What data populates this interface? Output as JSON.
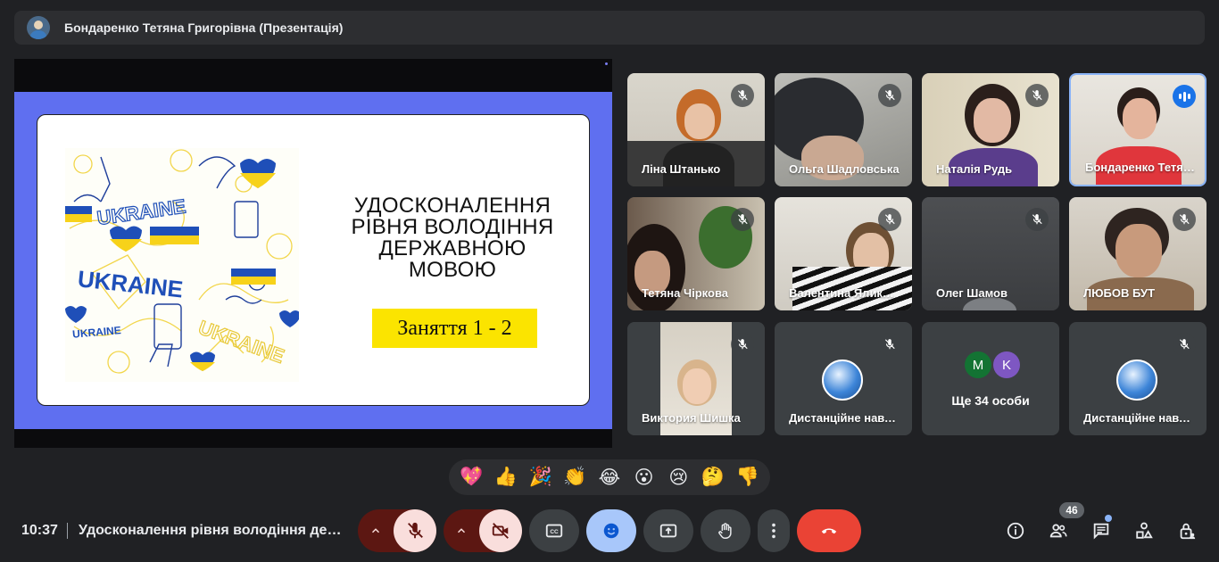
{
  "header": {
    "presenter_title": "Бондаренко Тетяна Григорівна (Презентація)"
  },
  "slide": {
    "title_lines": [
      "УДОСКОНАЛЕННЯ",
      "РІВНЯ ВОЛОДІННЯ",
      "ДЕРЖАВНОЮ",
      "МОВОЮ"
    ],
    "lesson_label": "Заняття 1 - 2",
    "art_words": [
      "UKRAINE",
      "UKRAINE",
      "UKRAINE",
      "UKRAINE"
    ]
  },
  "participants": [
    {
      "name": "Ліна Штанько",
      "muted": true
    },
    {
      "name": "Ольга Шадловська",
      "muted": true
    },
    {
      "name": "Наталія Рудь",
      "muted": true
    },
    {
      "name": "Бондаренко Тетяна",
      "muted": false,
      "speaking": true
    },
    {
      "name": "Тетяна Чіркова",
      "muted": true
    },
    {
      "name": "Валентина Яликова",
      "muted": true
    },
    {
      "name": "Олег Шамов",
      "muted": true
    },
    {
      "name": "ЛЮБОВ БУТ",
      "muted": true
    },
    {
      "name": "Виктория Шишка",
      "muted": true
    },
    {
      "name": "Дистанційне навчання",
      "muted": true
    },
    {
      "name": "Ще 34 особи",
      "avatars": [
        {
          "letter": "M",
          "color": "#137333"
        },
        {
          "letter": "K",
          "color": "#7e57c2"
        }
      ]
    },
    {
      "name": "Дистанційне навчання",
      "muted": true
    }
  ],
  "reactions": [
    "💖",
    "👍",
    "🎉",
    "👏",
    "😂",
    "😮",
    "😢",
    "🤔",
    "👎"
  ],
  "bottom": {
    "time": "10:37",
    "meeting_title": "Удосконалення рівня володіння державною мовою",
    "participants_count": "46"
  },
  "colors": {
    "end_call": "#ea4335",
    "emoji_active": "#a8c7fa",
    "muted_bg": "#f9dedc",
    "slide_bg": "#5f6ff0",
    "highlight": "#fbe400"
  }
}
